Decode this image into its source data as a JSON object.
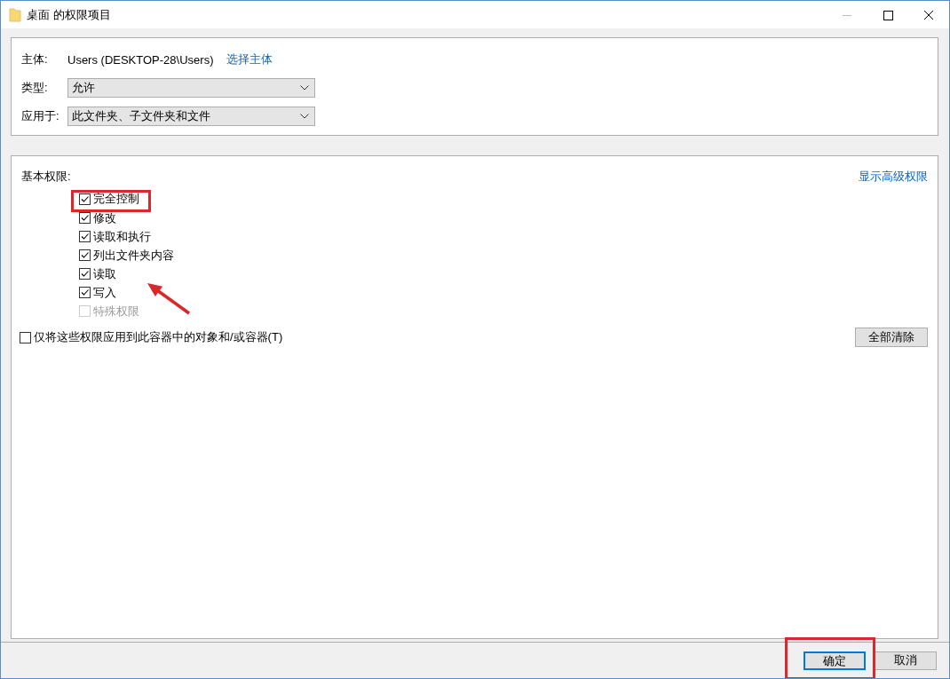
{
  "window": {
    "title": "桌面 的权限项目"
  },
  "principal": {
    "label": "主体:",
    "value": "Users (DESKTOP-28\\Users)",
    "link": "选择主体"
  },
  "fields": [
    {
      "label": "类型:",
      "value": "允许"
    },
    {
      "label": "应用于:",
      "value": "此文件夹、子文件夹和文件"
    }
  ],
  "permissions": {
    "heading": "基本权限:",
    "advanced_link": "显示高级权限",
    "items": [
      {
        "label": "完全控制",
        "checked": true,
        "disabled": false
      },
      {
        "label": "修改",
        "checked": true,
        "disabled": false
      },
      {
        "label": "读取和执行",
        "checked": true,
        "disabled": false
      },
      {
        "label": "列出文件夹内容",
        "checked": true,
        "disabled": false
      },
      {
        "label": "读取",
        "checked": true,
        "disabled": false
      },
      {
        "label": "写入",
        "checked": true,
        "disabled": false
      },
      {
        "label": "特殊权限",
        "checked": false,
        "disabled": true
      }
    ]
  },
  "apply_only": {
    "label": "仅将这些权限应用到此容器中的对象和/或容器(T)",
    "checked": false
  },
  "clear_all_button": "全部清除",
  "buttons": [
    {
      "label": "确定",
      "default": true
    },
    {
      "label": "取消",
      "default": false
    }
  ]
}
